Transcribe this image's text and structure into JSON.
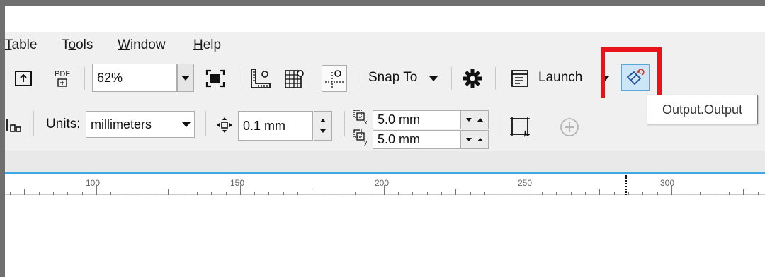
{
  "menu": {
    "items": [
      {
        "label": "Table"
      },
      {
        "label": "Tools"
      },
      {
        "label": "Window"
      },
      {
        "label": "Help"
      }
    ]
  },
  "toolbar1": {
    "zoom_value": "62%",
    "snap_label": "Snap To",
    "launch_label": "Launch",
    "pdf_label": "PDF"
  },
  "toolbar2": {
    "units_label": "Units:",
    "units_value": "millimeters",
    "nudge_value": "0.1 mm",
    "dup_x_value": "5.0 mm",
    "dup_y_value": "5.0 mm"
  },
  "ruler": {
    "labels": [
      "100",
      "150",
      "200",
      "250",
      "300"
    ]
  },
  "tooltip": {
    "text": "Output.Output"
  },
  "colors": {
    "highlight": "#e8121b",
    "active_button": "#cde6f7",
    "ruler_line": "#3fa6e6"
  }
}
